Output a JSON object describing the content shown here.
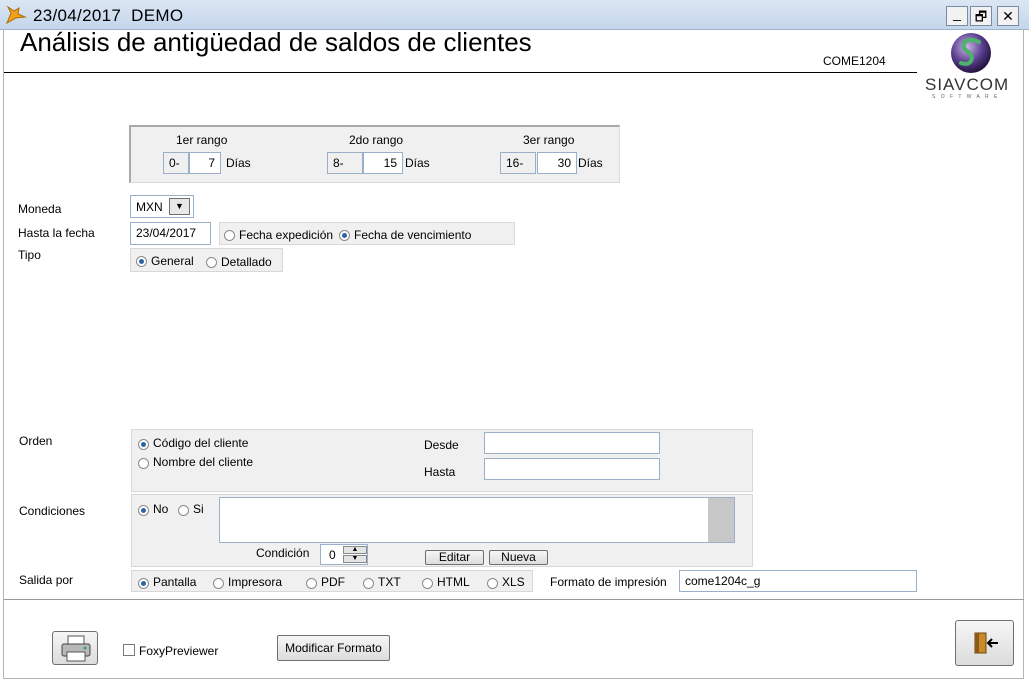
{
  "titlebar": {
    "date": "23/04/2017",
    "company": "DEMO",
    "minimize": "_",
    "restore": "🗗",
    "close": "✕"
  },
  "header": {
    "title": "Análisis de antigüedad de saldos de clientes",
    "code": "COME1204",
    "logo_text": "SIAVCOM",
    "logo_sub": "S O F T W A R E"
  },
  "ranges": [
    {
      "label": "1er rango",
      "from": "0-",
      "to": "7",
      "unit": "Días"
    },
    {
      "label": "2do rango",
      "from": "8-",
      "to": "15",
      "unit": "Días"
    },
    {
      "label": "3er rango",
      "from": "16-",
      "to": "30",
      "unit": "Días"
    }
  ],
  "moneda": {
    "label": "Moneda",
    "value": "MXN"
  },
  "fecha": {
    "label": "Hasta la fecha",
    "value": "23/04/2017",
    "opt1": "Fecha expedición",
    "opt2": "Fecha de vencimiento"
  },
  "tipo": {
    "label": "Tipo",
    "opt1": "General",
    "opt2": "Detallado"
  },
  "orden": {
    "label": "Orden",
    "opt1": "Código del cliente",
    "opt2": "Nombre del cliente",
    "desde": "Desde",
    "hasta": "Hasta",
    "desde_value": "",
    "hasta_value": ""
  },
  "condiciones": {
    "label": "Condiciones",
    "opt_no": "No",
    "opt_si": "Si",
    "condicion_label": "Condición",
    "condicion_value": "0",
    "editar": "Editar",
    "nueva": "Nueva"
  },
  "salida": {
    "label": "Salida por",
    "options": [
      "Pantalla",
      "Impresora",
      "PDF",
      "TXT",
      "HTML",
      "XLS"
    ],
    "formato_label": "Formato de impresión",
    "formato_value": "come1204c_g"
  },
  "footer": {
    "foxy": "FoxyPreviewer",
    "modificar": "Modificar Formato"
  }
}
